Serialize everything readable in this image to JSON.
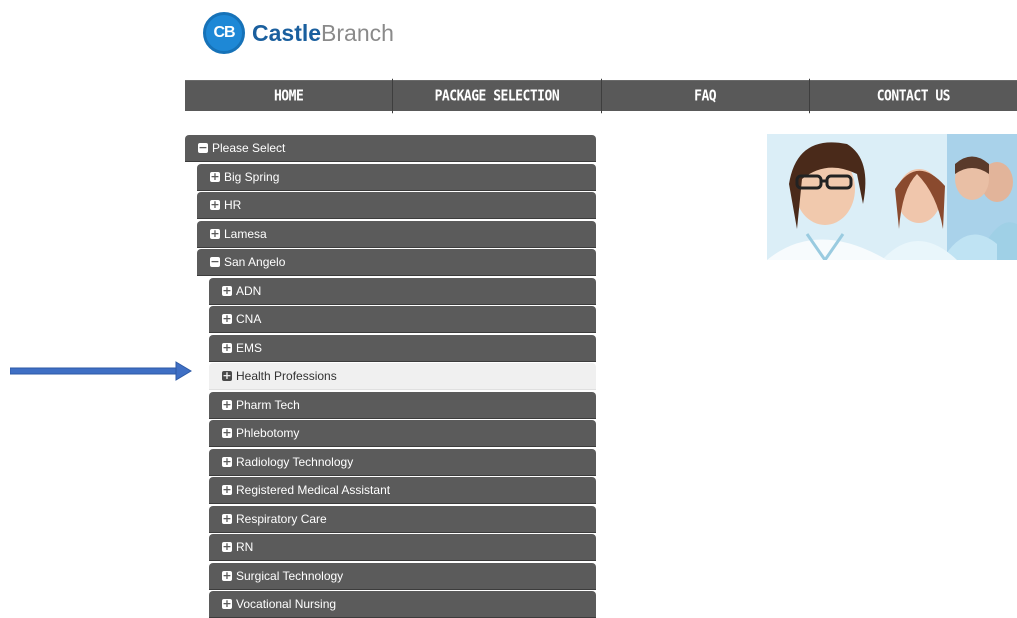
{
  "brand": {
    "mark": "CB",
    "name_part1": "Castle",
    "name_part2": "Branch"
  },
  "nav": {
    "items": [
      "HOME",
      "PACKAGE SELECTION",
      "FAQ",
      "CONTACT US"
    ]
  },
  "tree": {
    "root": {
      "label": "Please Select",
      "state": "expanded"
    },
    "campuses": [
      {
        "label": "Big Spring",
        "state": "collapsed"
      },
      {
        "label": "HR",
        "state": "collapsed"
      },
      {
        "label": "Lamesa",
        "state": "collapsed"
      },
      {
        "label": "San Angelo",
        "state": "expanded"
      }
    ],
    "programs": [
      {
        "label": "ADN",
        "state": "collapsed"
      },
      {
        "label": "CNA",
        "state": "collapsed"
      },
      {
        "label": "EMS",
        "state": "collapsed"
      },
      {
        "label": "Health Professions",
        "state": "collapsed",
        "highlighted": true
      },
      {
        "label": "Pharm Tech",
        "state": "collapsed"
      },
      {
        "label": "Phlebotomy",
        "state": "collapsed"
      },
      {
        "label": "Radiology Technology",
        "state": "collapsed"
      },
      {
        "label": "Registered Medical Assistant",
        "state": "collapsed"
      },
      {
        "label": "Respiratory Care",
        "state": "collapsed"
      },
      {
        "label": "RN",
        "state": "collapsed"
      },
      {
        "label": "Surgical Technology",
        "state": "collapsed"
      },
      {
        "label": "Vocational Nursing",
        "state": "collapsed"
      }
    ]
  },
  "icons": {
    "expanded": "minus-icon",
    "collapsed": "plus-icon"
  },
  "colors": {
    "brand_blue": "#1e88d6",
    "brand_dark_blue": "#1a5f9e",
    "nav_bg": "#595959",
    "row_bg": "#5b5b5b",
    "row_highlight_bg": "#f0f0f0",
    "arrow_blue": "#3f6fc4"
  }
}
